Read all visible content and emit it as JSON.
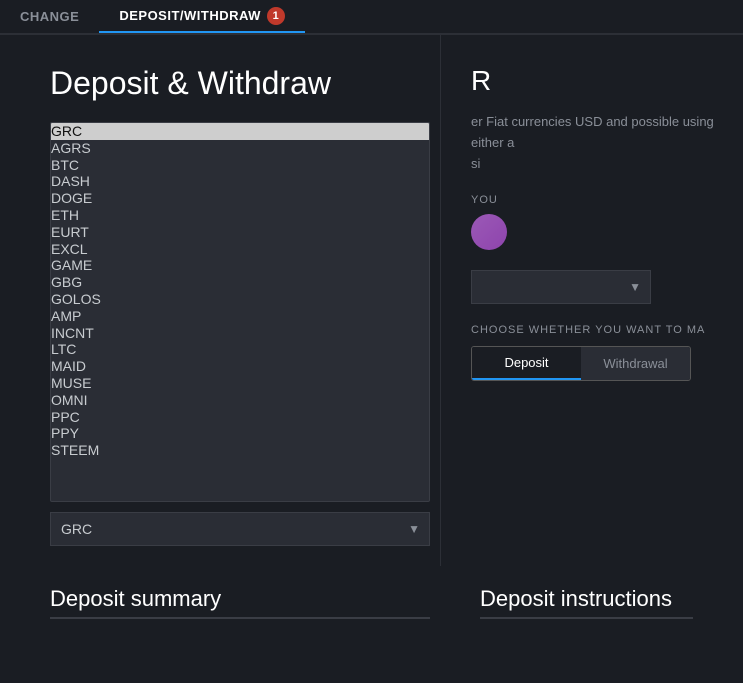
{
  "nav": {
    "tab1": {
      "label": "CHANGE",
      "active": false
    },
    "tab2": {
      "label": "DEPOSIT/WITHDRAW",
      "active": true,
      "badge": "1"
    }
  },
  "page": {
    "title": "Deposit & Withdraw"
  },
  "currencies": [
    {
      "code": "GRC",
      "selected": true
    },
    {
      "code": "AGRS",
      "selected": false
    },
    {
      "code": "BTC",
      "selected": false
    },
    {
      "code": "DASH",
      "selected": false
    },
    {
      "code": "DOGE",
      "selected": false
    },
    {
      "code": "ETH",
      "selected": false
    },
    {
      "code": "EURT",
      "selected": false
    },
    {
      "code": "EXCL",
      "selected": false
    },
    {
      "code": "GAME",
      "selected": false
    },
    {
      "code": "GBG",
      "selected": false
    },
    {
      "code": "GOLOS",
      "selected": false
    },
    {
      "code": "AMP",
      "selected": false
    },
    {
      "code": "INCNT",
      "selected": false
    },
    {
      "code": "LTC",
      "selected": false
    },
    {
      "code": "MAID",
      "selected": false
    },
    {
      "code": "MUSE",
      "selected": false
    },
    {
      "code": "OMNI",
      "selected": false
    },
    {
      "code": "PPC",
      "selected": false
    },
    {
      "code": "PPY",
      "selected": false
    },
    {
      "code": "STEEM",
      "selected": false
    }
  ],
  "selected_currency": "GRC",
  "right_panel": {
    "title": "R",
    "text_partial": "er Fiat currencies USD and possible using either a",
    "text_partial2": "si",
    "you_label": "YOU",
    "choose_label": "CHOOSE WHETHER YOU WANT TO MA"
  },
  "toggle": {
    "deposit_label": "Deposit",
    "withdrawal_label": "Withdrawal"
  },
  "bottom": {
    "deposit_summary_label": "Deposit summary",
    "deposit_instructions_label": "Deposit instructions"
  }
}
